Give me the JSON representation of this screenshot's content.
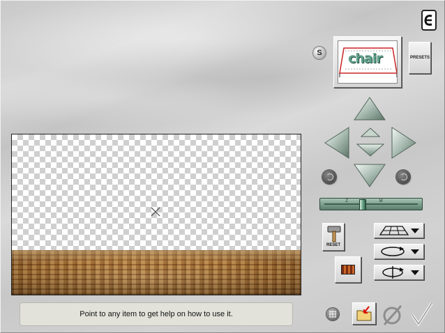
{
  "header": {
    "help_icon": "e-logo-icon",
    "s_button_label": "S",
    "presets_label": "PRESETS",
    "thumbnail_text": "chair"
  },
  "preview": {
    "background": "checkerboard-transparency",
    "floor_texture": "wood-parquet"
  },
  "navigation": {
    "icons": [
      "arrow-up-icon",
      "arrow-left-icon",
      "arrow-right-icon",
      "arrow-down-icon",
      "raise-icon",
      "lower-icon",
      "rotate-left-icon",
      "rotate-right-icon"
    ]
  },
  "zoom_slider": {
    "tick_labels": [
      "Z",
      "O",
      "M"
    ],
    "value": 0.4
  },
  "tools": {
    "reset_label": "RESET",
    "dropdowns": [
      "perspective-grid-icon",
      "rotate-horizontal-icon",
      "rotate-vertical-icon"
    ],
    "texture_icon": "texture-swatch-icon"
  },
  "status_bar": {
    "text": "Point to any item to get help on how to use it."
  },
  "footer": {
    "icons": [
      "grid-icon",
      "import-icon",
      "cancel-icon",
      "ok-icon"
    ]
  },
  "colors": {
    "panel": "#cfcfcf",
    "button_green": "#7ea08e",
    "floor_wood": "#9a6428"
  }
}
